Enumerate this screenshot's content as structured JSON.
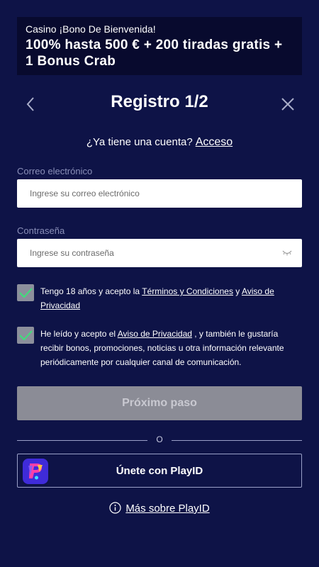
{
  "banner": {
    "subtitle": "Casino ¡Bono De Bienvenida!",
    "title": "100% hasta 500 € + 200 tiradas gratis + 1 Bonus Crab"
  },
  "header": {
    "title": "Registro 1/2",
    "back_icon": "chevron-left-icon",
    "close_icon": "close-icon"
  },
  "account": {
    "question": "¿Ya tiene una cuenta?",
    "link": "Acceso"
  },
  "email": {
    "label": "Correo electrónico",
    "placeholder": "Ingrese su correo electrónico",
    "value": ""
  },
  "password": {
    "label": "Contraseña",
    "placeholder": "Ingrese su contraseña",
    "value": "",
    "icon": "eye-hidden-icon"
  },
  "consent_terms": {
    "checked": true,
    "text_before": "Tengo 18 años y acepto la ",
    "terms_link": "Términos y Condiciones",
    "text_middle": " y ",
    "privacy_link": "Aviso de Privacidad"
  },
  "consent_marketing": {
    "checked": true,
    "text_before": "He leído y acepto el ",
    "privacy_link": "Aviso de Privacidad",
    "text_after": " , y también le gustaría recibir bonos, promociones, noticias u otra información relevante periódicamente por cualquier canal de comunicación."
  },
  "next_button": {
    "label": "Próximo paso",
    "disabled": true
  },
  "divider": {
    "label": "O"
  },
  "playid": {
    "label": "Únete con PlayID",
    "more_link": "Más sobre PlayID",
    "info_icon": "info-icon"
  },
  "colors": {
    "background": "#0e1347",
    "banner": "#080a2e",
    "checkbox": "#8c8f9c",
    "checkmark": "#3ee07a",
    "button_disabled": "#8b8c96"
  }
}
